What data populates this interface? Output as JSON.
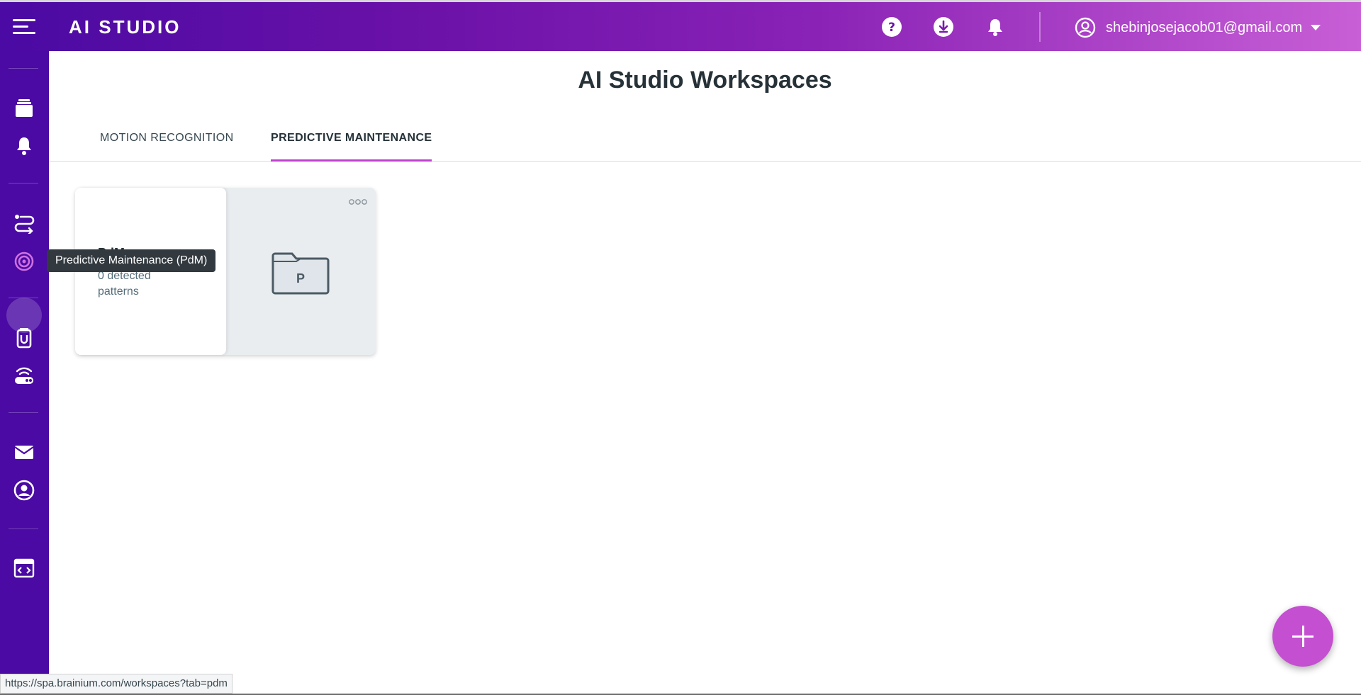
{
  "topbar": {
    "brand": "AI STUDIO",
    "user_email": "shebinjosejacob01@gmail.com",
    "icons": [
      "help-icon",
      "download-icon",
      "bell-icon",
      "account-icon"
    ]
  },
  "sidebar": {
    "icons": [
      "projects-icon",
      "notifications-icon",
      "routes-icon",
      "pdm-icon",
      "device-icon",
      "gateway-icon",
      "mail-icon",
      "profile-icon",
      "code-window-icon"
    ]
  },
  "page": {
    "title": "AI Studio Workspaces",
    "tabs": [
      {
        "label": "MOTION RECOGNITION",
        "active": false
      },
      {
        "label": "PREDICTIVE MAINTENANCE",
        "active": true
      }
    ]
  },
  "workspace_card": {
    "name": "PdM",
    "subtitle": "0 detected patterns",
    "folder_letter": "P"
  },
  "tooltip": {
    "text": "Predictive Maintenance (PdM)"
  },
  "status_bar": {
    "url": "https://spa.brainium.com/workspaces?tab=pdm"
  },
  "colors": {
    "sidebar": "#4a0aa3",
    "accent": "#c44fd1",
    "tab_underline": "#c040d0",
    "title": "#263238"
  }
}
